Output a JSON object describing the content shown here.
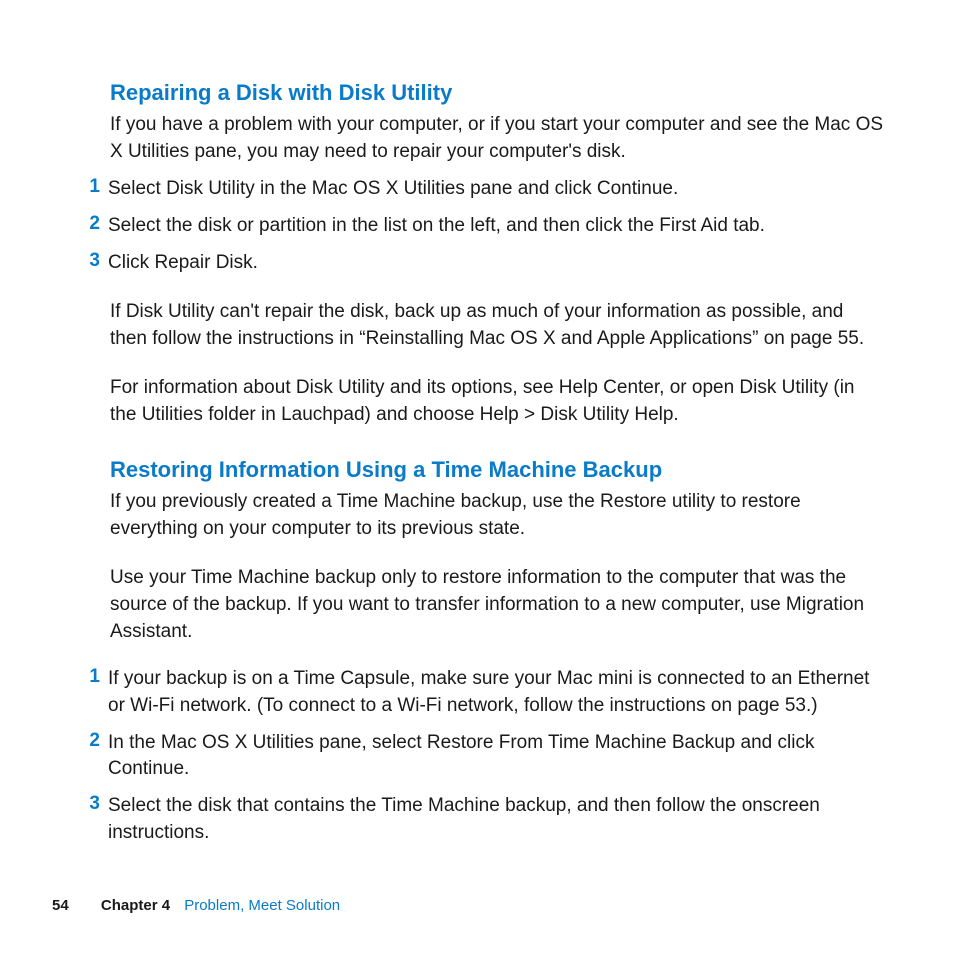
{
  "section1": {
    "heading": "Repairing a Disk with Disk Utility",
    "intro": "If you have a problem with your computer, or if you start your computer and see the Mac OS X Utilities pane, you may need to repair your computer's disk.",
    "steps": {
      "s1_num": "1",
      "s1_txt": "Select Disk Utility in the Mac OS X Utilities pane and click Continue.",
      "s2_num": "2",
      "s2_txt": "Select the disk or partition in the list on the left, and then click the First Aid tab.",
      "s3_num": "3",
      "s3_txt": "Click Repair Disk."
    },
    "para1": "If Disk Utility can't repair the disk, back up as much of your information as possible, and then follow the instructions in “Reinstalling Mac OS X and Apple Applications” on page 55.",
    "para2": "For information about Disk Utility and its options, see Help Center, or open Disk Utility (in the Utilities folder in Lauchpad) and choose Help > Disk Utility Help."
  },
  "section2": {
    "heading": "Restoring Information Using a Time Machine Backup",
    "intro": "If you previously created a Time Machine backup, use the Restore utility to restore everything on your computer to its previous state.",
    "para1": "Use your Time Machine backup only to restore information to the computer that was the source of the backup. If you want to transfer information to a new computer, use Migration Assistant.",
    "steps": {
      "s1_num": "1",
      "s1_txt": "If your backup is on a Time Capsule, make sure your Mac mini is connected to an Ethernet or Wi-Fi network. (To connect to a Wi-Fi network, follow the instructions on page 53.)",
      "s2_num": "2",
      "s2_txt": "In the Mac OS X Utilities pane, select Restore From Time Machine Backup and click Continue.",
      "s3_num": "3",
      "s3_txt": "Select the disk that contains the Time Machine backup, and then follow the onscreen instructions."
    }
  },
  "footer": {
    "page_number": "54",
    "chapter_label": "Chapter 4",
    "chapter_title": "Problem, Meet Solution"
  }
}
